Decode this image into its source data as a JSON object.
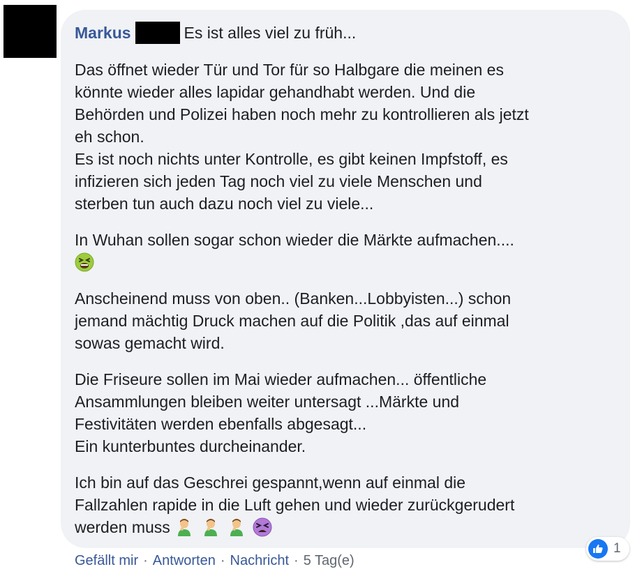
{
  "comment": {
    "author": "Markus",
    "author_surname_redacted": true,
    "header_text": "Es ist alles viel zu früh...",
    "paragraphs": [
      {
        "lines": [
          "Das öffnet wieder Tür und Tor für so Halbgare die meinen es",
          "könnte wieder alles lapidar gehandhabt werden. Und die",
          "Behörden und Polizei haben noch mehr zu kontrollieren als jetzt",
          "eh schon.",
          "Es ist noch nichts unter Kontrolle, es gibt keinen Impfstoff, es",
          "infizieren sich jeden Tag noch viel zu viele Menschen und",
          "sterben tun auch dazu noch viel zu viele..."
        ]
      },
      {
        "lines": [
          "In Wuhan sollen sogar schon wieder die Märkte aufmachen...."
        ],
        "emoji_line": [
          "nauseated-face"
        ]
      },
      {
        "lines": [
          "Anscheinend muss von oben.. (Banken...Lobbyisten...) schon",
          "jemand mächtig Druck machen auf die Politik ,das auf einmal",
          "sowas gemacht wird."
        ]
      },
      {
        "lines": [
          "Die Friseure sollen im Mai wieder aufmachen... öffentliche",
          "Ansammlungen bleiben weiter untersagt ...Märkte und",
          "Festivitäten werden ebenfalls abgesagt...",
          "Ein kunterbuntes durcheinander."
        ]
      },
      {
        "lines": [
          "Ich bin auf das Geschrei gespannt,wenn auf einmal die",
          "Fallzahlen rapide in die Luft gehen und wieder zurückgerudert",
          "werden muss"
        ],
        "trailing_emojis": [
          "man-facepalming",
          "man-facepalming",
          "man-facepalming",
          "tired-face"
        ]
      }
    ],
    "reactions": {
      "type": "like",
      "count": "1"
    },
    "actions": {
      "like": "Gefällt mir",
      "reply": "Antworten",
      "message": "Nachricht",
      "separator": "·",
      "timestamp": "5 Tag(e)"
    }
  },
  "colors": {
    "bubble": "#f0f2f5",
    "link": "#385898",
    "text": "#1c1e21",
    "meta": "#606770",
    "like_blue": "#1877f2"
  }
}
